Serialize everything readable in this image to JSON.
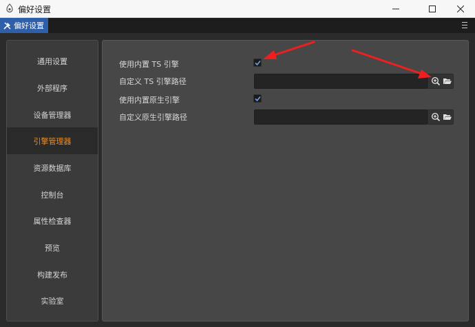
{
  "window": {
    "title": "偏好设置",
    "app_icon": "app-logo-icon",
    "minimize_icon": "minimize-icon",
    "maximize_icon": "maximize-icon",
    "close_icon": "close-icon"
  },
  "tabbar": {
    "tab_label": "偏好设置",
    "tab_icon": "tools-icon",
    "menu_icon": "hamburger-menu-icon",
    "tab_color": "#2f5fa8"
  },
  "sidebar": {
    "active_color": "#e98d2a",
    "items": [
      {
        "label": "通用设置"
      },
      {
        "label": "外部程序"
      },
      {
        "label": "设备管理器"
      },
      {
        "label": "引擎管理器",
        "active": true
      },
      {
        "label": "资源数据库"
      },
      {
        "label": "控制台"
      },
      {
        "label": "属性检查器"
      },
      {
        "label": "预览"
      },
      {
        "label": "构建发布"
      },
      {
        "label": "实验室"
      }
    ]
  },
  "engine": {
    "use_builtin_ts": {
      "label": "使用内置 TS 引擎",
      "checked": true
    },
    "custom_ts_path": {
      "label": "自定义 TS 引擎路径",
      "value": ""
    },
    "use_builtin_native": {
      "label": "使用内置原生引擎",
      "checked": true
    },
    "custom_native_path": {
      "label": "自定义原生引擎路径",
      "value": ""
    },
    "search_icon": "zoom-search-icon",
    "folder_icon": "open-folder-icon"
  },
  "annotations": {
    "color": "#f01f1f"
  }
}
